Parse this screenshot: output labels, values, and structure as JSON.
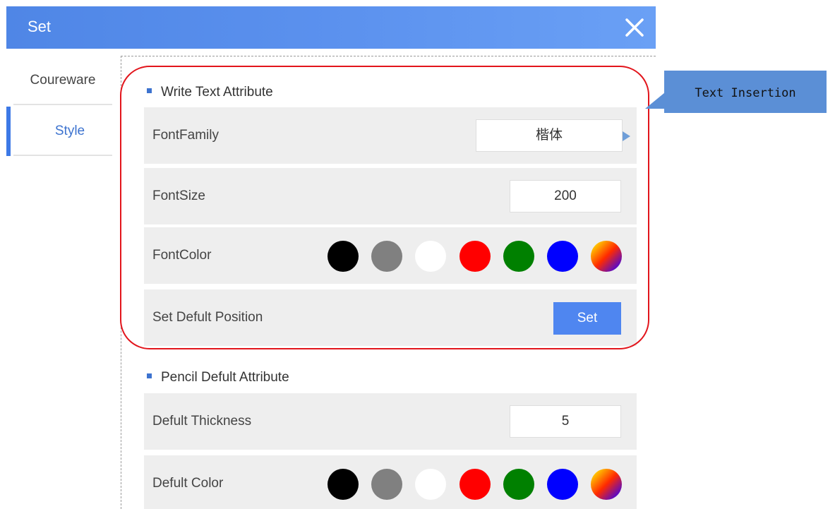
{
  "dialog": {
    "title": "Set",
    "close_icon": "close-icon"
  },
  "sidebar": {
    "items": [
      {
        "label": "Coureware",
        "active": false
      },
      {
        "label": "Style",
        "active": true
      }
    ]
  },
  "sections": {
    "write_text": {
      "title": "Write Text Attribute",
      "font_family": {
        "label": "FontFamily",
        "value": "楷体"
      },
      "font_size": {
        "label": "FontSize",
        "value": "200"
      },
      "font_color": {
        "label": "FontColor"
      },
      "default_position": {
        "label": "Set Defult Position",
        "button": "Set"
      }
    },
    "pencil": {
      "title": "Pencil Defult Attribute",
      "thickness": {
        "label": "Defult Thickness",
        "value": "5"
      },
      "color": {
        "label": "Defult Color"
      }
    }
  },
  "swatches": [
    "#000000",
    "#808080",
    "#ffffff",
    "#ff0000",
    "#008000",
    "#0000ff",
    "gradient"
  ],
  "annotation": {
    "text": "Text Insertion",
    "highlight_color": "#e2151c",
    "callout_color": "#5b8fd6"
  },
  "colors": {
    "titlebar": "#5b91ee",
    "accent": "#3d79e6",
    "button": "#4f86f0"
  }
}
